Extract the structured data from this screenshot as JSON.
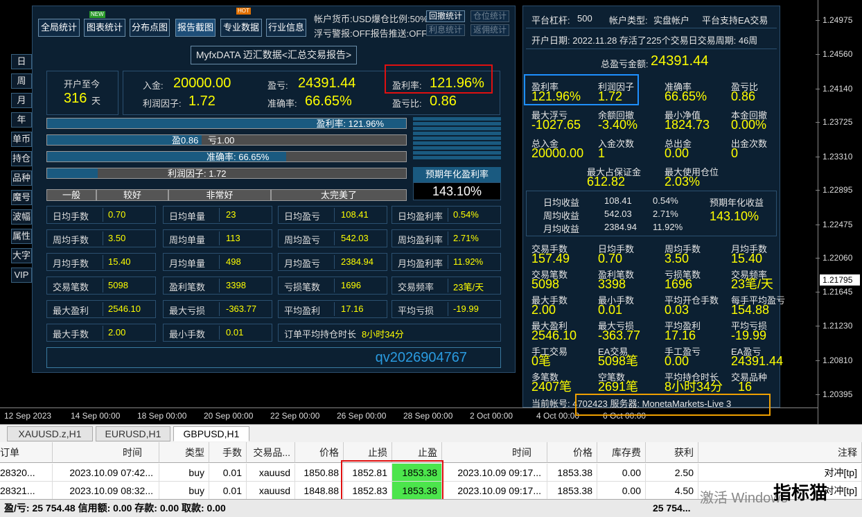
{
  "left_tabs": [
    "日",
    "周",
    "月",
    "年",
    "单币",
    "持仓",
    "品种",
    "魔号",
    "波幅",
    "属性",
    "大字",
    "VIP"
  ],
  "toolbar": {
    "buttons": [
      "全局统计",
      "图表统计",
      "分布点图",
      "报告截图",
      "专业数据",
      "行业信息"
    ],
    "new_badge": "NEW",
    "hot_badge": "HOT",
    "account_line1": "帐户货币:USD爆仓比例:50%",
    "account_line2": "浮亏警报:OFF报告推送:OFF",
    "small_buttons": [
      "回撤统计",
      "仓位统计",
      "利息统计",
      "返佣统计"
    ]
  },
  "report_title": "MyfxDATA 迈汇数据<汇总交易报告>",
  "summary": {
    "since_label": "开户至今",
    "since_value": "316",
    "since_unit": "天",
    "deposit_label": "入金:",
    "deposit_value": "20000.00",
    "pnl_label": "盈亏:",
    "pnl_value": "24391.44",
    "profit_rate_label": "盈利率:",
    "profit_rate_value": "121.96%",
    "profit_factor_label": "利润因子:",
    "profit_factor_value": "1.72",
    "accuracy_label": "准确率:",
    "accuracy_value": "66.65%",
    "pl_ratio_label": "盈亏比:",
    "pl_ratio_value": "0.86"
  },
  "bars": [
    {
      "text": "盈利率: 121.96%",
      "fraction": 1.0
    },
    {
      "text_left": "盈0.86",
      "text_right": "亏1.00",
      "fraction": 0.43
    },
    {
      "text": "准确率: 66.65%",
      "fraction": 0.6665
    },
    {
      "text": "利润因子: 1.72",
      "fraction": 0.14
    }
  ],
  "ratings": [
    "一般",
    "较好",
    "非常好",
    "太完美了"
  ],
  "annual": {
    "label": "预期年化盈利率",
    "value": "143.10%"
  },
  "stats_grid": [
    [
      "日均手数",
      "0.70",
      "日均单量",
      "23",
      "日均盈亏",
      "108.41",
      "日均盈利率",
      "0.54%"
    ],
    [
      "周均手数",
      "3.50",
      "周均单量",
      "113",
      "周均盈亏",
      "542.03",
      "周均盈利率",
      "2.71%"
    ],
    [
      "月均手数",
      "15.40",
      "月均单量",
      "498",
      "月均盈亏",
      "2384.94",
      "月均盈利率",
      "11.92%"
    ],
    [
      "交易笔数",
      "5098",
      "盈利笔数",
      "3398",
      "亏损笔数",
      "1696",
      "交易频率",
      "23笔/天"
    ],
    [
      "最大盈利",
      "2546.10",
      "最大亏损",
      "-363.77",
      "平均盈利",
      "17.16",
      "平均亏损",
      "-19.99"
    ],
    [
      "最大手数",
      "2.00",
      "最小手数",
      "0.01",
      "订单平均持仓时长",
      "8小时34分"
    ]
  ],
  "contact": "qv2026904767",
  "right": {
    "leverage_label": "平台杠杆:",
    "leverage_value": "500",
    "acct_type_label": "帐户类型:",
    "acct_type_value": "实盘帐户",
    "ea_support": "平台支持EA交易",
    "open_date_line": "开户日期: 2022.11.28 存活了225个交易日交易周期: 46周",
    "total_pnl_label": "总盈亏金额:",
    "total_pnl_value": "24391.44",
    "blocks": [
      [
        [
          "盈利率",
          "121.96%"
        ],
        [
          "利润因子",
          "1.72"
        ],
        [
          "准确率",
          "66.65%"
        ],
        [
          "盈亏比",
          "0.86"
        ]
      ],
      [
        [
          "最大浮亏",
          "-1027.65"
        ],
        [
          "余额回撤",
          "-3.40%"
        ],
        [
          "最小净值",
          "1824.73"
        ],
        [
          "本金回撤",
          "0.00%"
        ]
      ],
      [
        [
          "总入金",
          "20000.00"
        ],
        [
          "入金次数",
          "1"
        ],
        [
          "总出金",
          "0.00"
        ],
        [
          "出金次数",
          "0"
        ]
      ],
      [
        [
          "交易手数",
          "157.49"
        ],
        [
          "日均手数",
          "0.70"
        ],
        [
          "周均手数",
          "3.50"
        ],
        [
          "月均手数",
          "15.40"
        ]
      ],
      [
        [
          "交易笔数",
          "5098"
        ],
        [
          "盈利笔数",
          "3398"
        ],
        [
          "亏损笔数",
          "1696"
        ],
        [
          "交易频率",
          "23笔/天"
        ]
      ],
      [
        [
          "最大手数",
          "2.00"
        ],
        [
          "最小手数",
          "0.01"
        ],
        [
          "平均开仓手数",
          "0.03"
        ],
        [
          "每手平均盈亏",
          "154.88"
        ]
      ],
      [
        [
          "最大盈利",
          "2546.10"
        ],
        [
          "最大亏损",
          "-363.77"
        ],
        [
          "平均盈利",
          "17.16"
        ],
        [
          "平均亏损",
          "-19.99"
        ]
      ],
      [
        [
          "手工交易",
          "0笔"
        ],
        [
          "EA交易",
          "5098笔"
        ],
        [
          "手工盈亏",
          "0.00"
        ],
        [
          "EA盈亏",
          "24391.44"
        ]
      ],
      [
        [
          "多笔数",
          "2407笔"
        ],
        [
          "空笔数",
          "2691笔"
        ],
        [
          "平均持仓时长",
          "8小时34分"
        ],
        [
          "交易品种",
          "16"
        ]
      ]
    ],
    "margin": [
      [
        "最大占保证金",
        "612.82"
      ],
      [
        "最大使用仓位",
        "2.03%"
      ]
    ],
    "earnings": {
      "rows": [
        [
          "日均收益",
          "108.41",
          "0.54%"
        ],
        [
          "周均收益",
          "542.03",
          "2.71%"
        ],
        [
          "月均收益",
          "2384.94",
          "11.92%"
        ]
      ],
      "annual_label": "预期年化收益",
      "annual_value": "143.10%"
    },
    "account_line": "当前帐号: 4702423 服务器: MonetaMarkets-Live 3"
  },
  "price_axis": [
    "1.24975",
    "1.24560",
    "1.24140",
    "1.23725",
    "1.23310",
    "1.22895",
    "1.22475",
    "1.22060",
    "1.21795",
    "1.21645",
    "1.21230",
    "1.20810",
    "1.20395"
  ],
  "current_price": "1.21795",
  "time_axis": [
    "12 Sep 2023",
    "14 Sep 00:00",
    "18 Sep 00:00",
    "20 Sep 00:00",
    "22 Sep 00:00",
    "26 Sep 00:00",
    "28 Sep 00:00",
    "2 Oct 00:00",
    "4 Oct 00:00",
    "6 Oct 00:00"
  ],
  "chart_tabs": [
    "XAUUSD.z,H1",
    "EURUSD,H1",
    "GBPUSD,H1"
  ],
  "orders": {
    "headers": [
      "订单",
      "时间",
      "类型",
      "手数",
      "交易品...",
      "价格",
      "止损",
      "止盈",
      "时间",
      "价格",
      "库存费",
      "获利",
      "注释"
    ],
    "rows": [
      [
        "28320...",
        "2023.10.09 07:42...",
        "buy",
        "0.01",
        "xauusd",
        "1850.88",
        "1852.81",
        "1853.38",
        "2023.10.09 09:17...",
        "1853.38",
        "0.00",
        "2.50",
        "对冲[tp]"
      ],
      [
        "28321...",
        "2023.10.09 08:32...",
        "buy",
        "0.01",
        "xauusd",
        "1848.88",
        "1852.83",
        "1853.38",
        "2023.10.09 09:17...",
        "1853.38",
        "0.00",
        "4.50",
        "对冲[tp]"
      ]
    ]
  },
  "status_bar": "盈/亏: 25 754.48 信用额: 0.00 存款: 0.00 取款: 0.00",
  "status_total": "25 754...",
  "watermark": "激活 Windows",
  "logo_text": "指标猫",
  "colors": {
    "accent_yellow": "#ffff00",
    "panel_bg": "#0c2032",
    "highlight_red": "#e01010",
    "highlight_blue": "#1e90ff",
    "highlight_orange": "#f0a000",
    "tp_green": "#4ce54c"
  }
}
